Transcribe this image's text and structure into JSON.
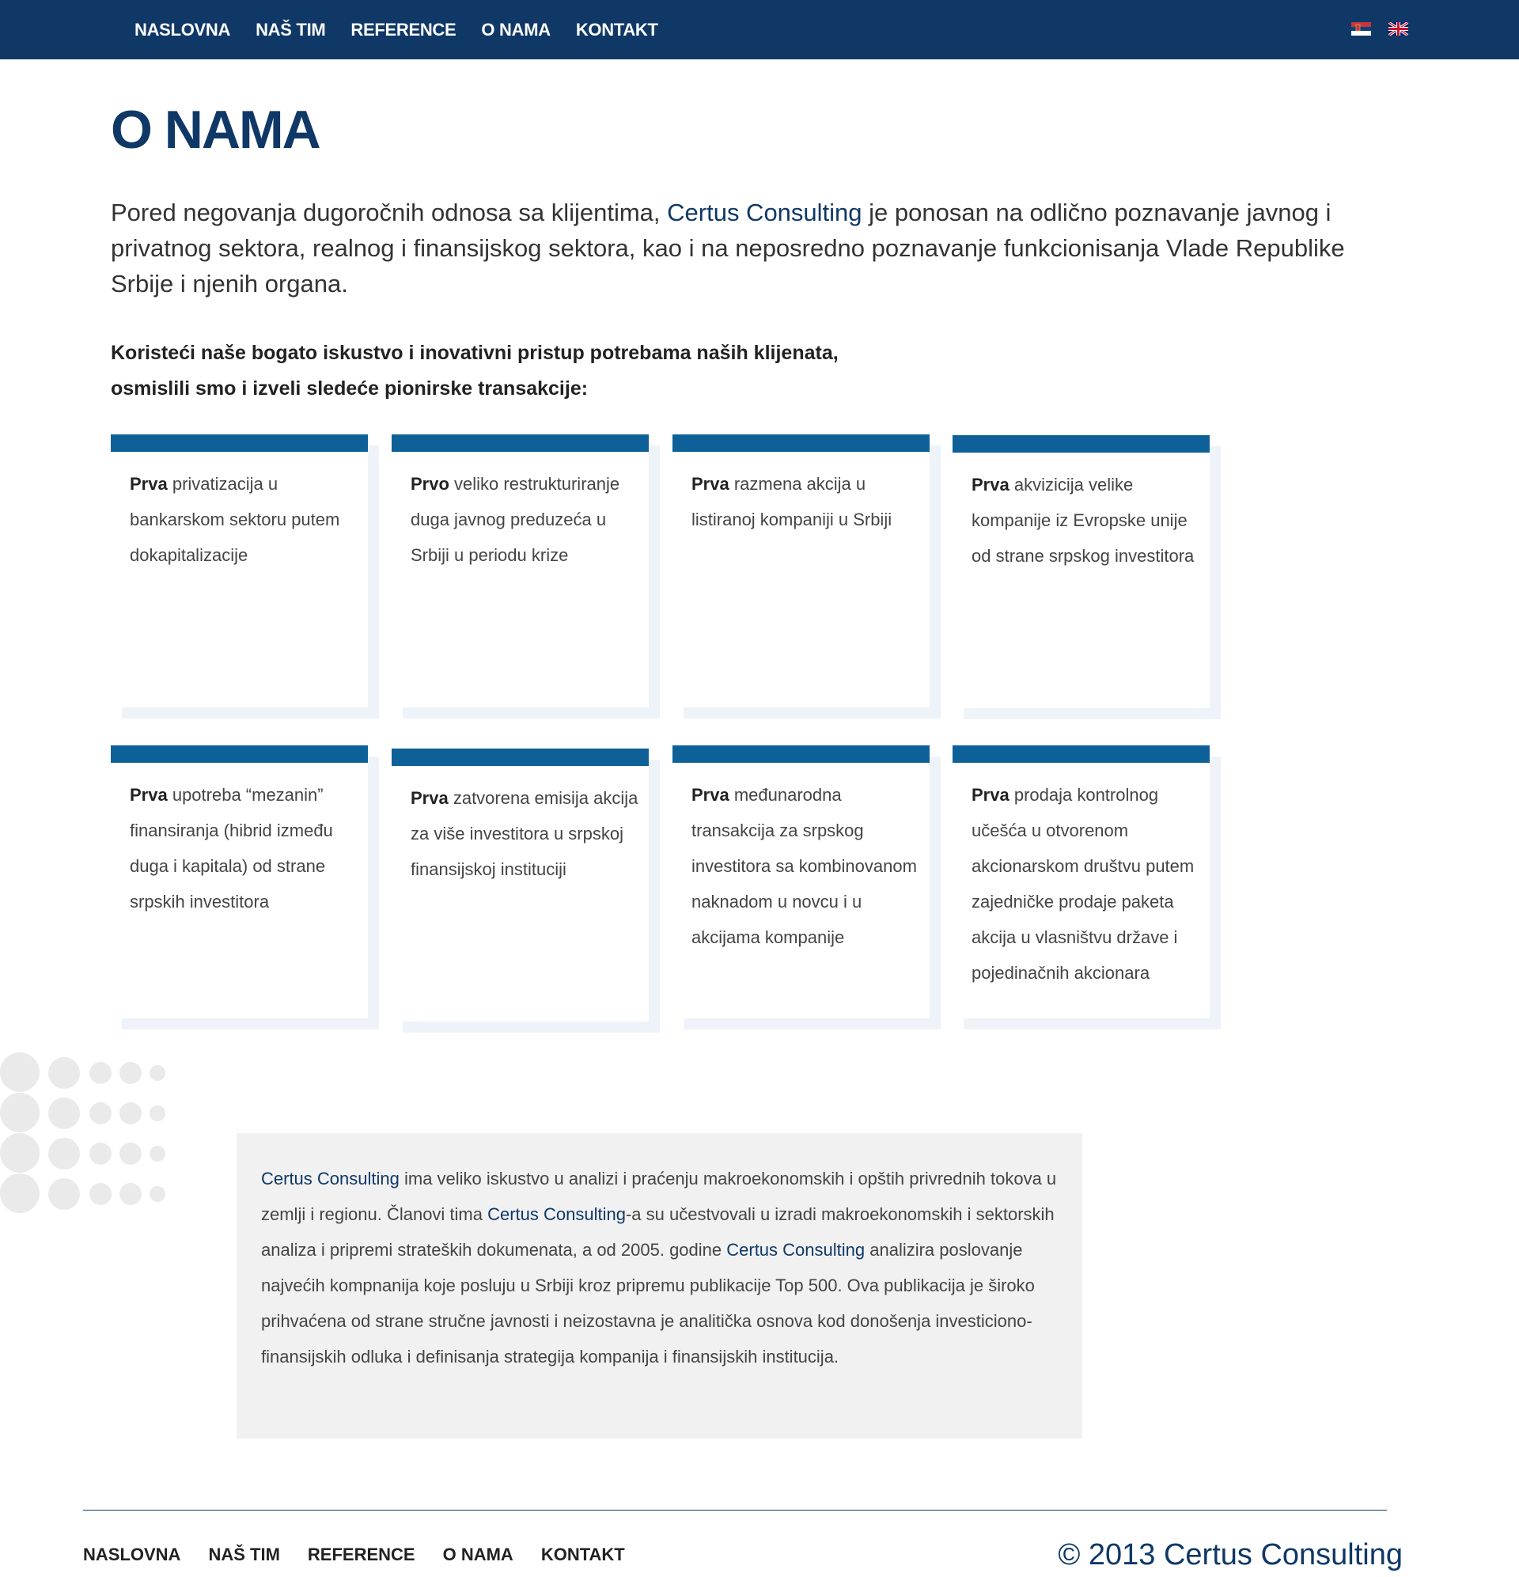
{
  "nav": {
    "items": [
      "NASLOVNA",
      "NAŠ TIM",
      "REFERENCE",
      "O NAMA",
      "KONTAKT"
    ],
    "languages": [
      "serbian-flag",
      "uk-flag"
    ]
  },
  "page": {
    "title": "O NAMA",
    "intro_before": "Pored negovanja dugoročnih odnosa sa klijentima, ",
    "intro_brand": "Certus Consulting",
    "intro_after": " je ponosan na odlično poznavanje javnog i privatnog sektora, realnog i finansijskog sektora, kao i na neposredno poznavanje funkcionisanja Vlade Republike Srbije i njenih organa.",
    "lead_line1": "Koristeći naše bogato iskustvo i inovativni pristup potrebama naših klijenata,",
    "lead_line2": "osmislili smo i izveli sledeće pionirske transakcije:"
  },
  "cards": [
    {
      "bold": "Prva",
      "text": " privatizacija u bankarskom sektoru putem dokapitalizacije"
    },
    {
      "bold": "Prvo",
      "text": " veliko restrukturiranje duga javnog preduzeća u Srbiji u periodu krize"
    },
    {
      "bold": "Prva",
      "text": " razmena akcija u listiranoj kompaniji u Srbiji"
    },
    {
      "bold": "Prva",
      "text": " akvizicija velike kompanije iz Evropske unije od strane srpskog investitora"
    },
    {
      "bold": "Prva",
      "text": " upotreba “mezanin” finansiranja (hibrid između duga i kapitala) od strane srpskih investitora"
    },
    {
      "bold": "Prva",
      "text": " zatvorena emisija akcija za više investitora u srpskoj finansijskoj instituciji"
    },
    {
      "bold": "Prva",
      "text": " međunarodna transakcija za srpskog investitora sa kombinovanom naknadom u novcu i u akcijama kompanije"
    },
    {
      "bold": "Prva",
      "text": " prodaja kontrolnog učešća u otvorenom akcionarskom društvu putem zajedničke prodaje paketa akcija u vlasništvu države i pojedinačnih akcionara"
    }
  ],
  "info": {
    "brand": "Certus Consulting",
    "p1": " ima veliko iskustvo u analizi i praćenju makroekonomskih i opštih privrednih tokova u zemlji i regionu. Članovi tima ",
    "p2": "-a su učestvovali u izradi makroekonomskih i sektorskih analiza i pripremi strateških dokumenata, a od 2005. godine ",
    "p3": " analizira poslovanje najvećih kompnanija koje posluju u Srbiji kroz pripremu publikacije Top 500. Ova publikacija je široko prihvaćena od strane stručne javnosti i neizostavna je analitička osnova kod donošenja investiciono-finansijskih odluka i definisanja strategija kompanija i finansijskih institucija."
  },
  "footer": {
    "items": [
      "NASLOVNA",
      "NAŠ TIM",
      "REFERENCE",
      "O NAMA",
      "KONTAKT"
    ],
    "copyright": "© 2013 Certus Consulting"
  },
  "colors": {
    "navy": "#0f3867",
    "card_bar": "#0e6198",
    "info_bg": "#f1f1f1"
  }
}
